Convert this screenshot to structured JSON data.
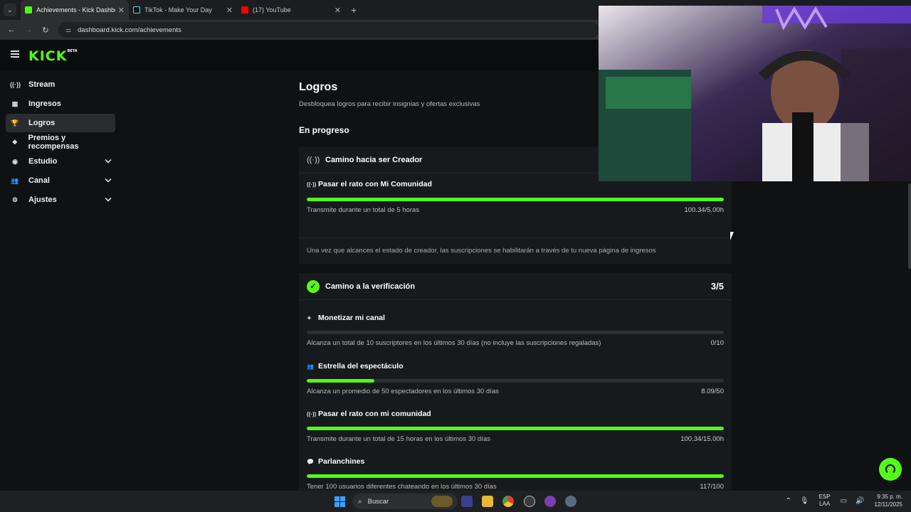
{
  "browser": {
    "tabs": [
      {
        "title": "Achievements - Kick Dashboard",
        "favicon_color": "#53fc18",
        "active": true
      },
      {
        "title": "TikTok - Make Your Day",
        "favicon_color": "#111111",
        "active": false
      },
      {
        "title": "(17) YouTube",
        "favicon_color": "#ff0000",
        "active": false
      }
    ],
    "url": "dashboard.kick.com/achievements"
  },
  "logo": {
    "text": "KICK",
    "badge": "BETA"
  },
  "sidebar": {
    "items": [
      {
        "label": "Stream",
        "icon": "broadcast-icon",
        "glyph": "((·))",
        "active": false,
        "expandable": false
      },
      {
        "label": "Ingresos",
        "icon": "chart-icon",
        "glyph": "▦",
        "active": false,
        "expandable": false
      },
      {
        "label": "Logros",
        "icon": "trophy-icon",
        "glyph": "🏆",
        "active": true,
        "expandable": false
      },
      {
        "label": "Premios y recompensas",
        "icon": "gift-icon",
        "glyph": "❖",
        "active": false,
        "expandable": false
      },
      {
        "label": "Estudio",
        "icon": "camera-icon",
        "glyph": "◉",
        "active": false,
        "expandable": true
      },
      {
        "label": "Canal",
        "icon": "users-icon",
        "glyph": "👥",
        "active": false,
        "expandable": true
      },
      {
        "label": "Ajustes",
        "icon": "gear-icon",
        "glyph": "⚙",
        "active": false,
        "expandable": true
      }
    ]
  },
  "main": {
    "title": "Logros",
    "subtitle": "Desbloquea logros para recibir insignias y ofertas exclusivas",
    "section": "En progreso",
    "card1": {
      "title": "Camino hacia ser Creador",
      "achievement": {
        "title": "Pasar el rato con Mi Comunidad",
        "description": "Transmite durante un total de 5 horas",
        "value": "100.34/5.00h",
        "progress": 1.0
      },
      "note": "Una vez que alcances el estado de creador, las suscripciones se habilitarán a través de tu nueva página de ingresos"
    },
    "card2": {
      "title": "Camino a la verificación",
      "count": "3/5",
      "achievements": [
        {
          "title": "Monetizar mi canal",
          "icon": "sparkle-icon",
          "glyph": "✦",
          "description": "Alcanza un total de 10 suscriptores en los últimos 30 días (no incluye las suscripciones regaladas)",
          "value": "0/10",
          "progress": 0.0
        },
        {
          "title": "Estrella del espectáculo",
          "icon": "users-icon",
          "glyph": "👥",
          "description": "Alcanza un promedio de 50 espectadores en los últimos 30 días",
          "value": "8.09/50",
          "progress": 0.1618
        },
        {
          "title": "Pasar el rato con mi comunidad",
          "icon": "broadcast-icon",
          "glyph": "((·))",
          "description": "Transmite durante un total de 15 horas en los últimos 30 días",
          "value": "100.34/15.00h",
          "progress": 1.0
        },
        {
          "title": "Parlanchines",
          "icon": "chat-icon",
          "glyph": "💬",
          "description": "Tener 100 usuarios diferentes chateando en los últimos 30 días",
          "value": "117/100",
          "progress": 1.0
        }
      ]
    }
  },
  "taskbar": {
    "search_placeholder": "Buscar",
    "lang_line1": "ESP",
    "lang_line2": "LAA",
    "time": "9:35 p. m.",
    "date": "12/11/2025"
  },
  "colors": {
    "accent": "#53fc18",
    "background": "#0f1112",
    "card": "#171a1c"
  }
}
